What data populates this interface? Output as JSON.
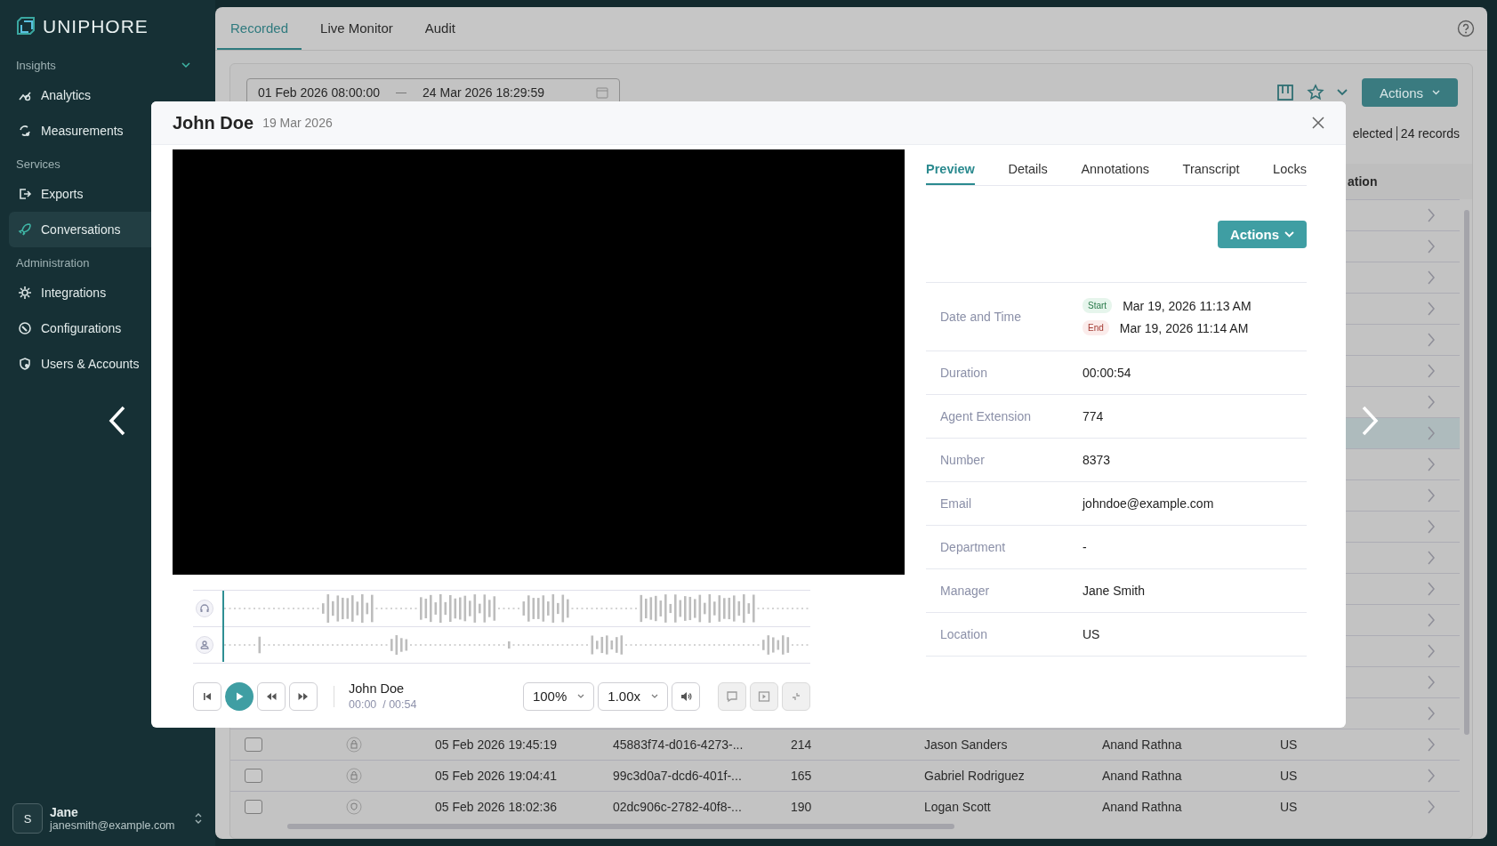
{
  "sidebar": {
    "logo": "UNIPHORE",
    "sections": [
      {
        "title": "Insights",
        "expanded": true,
        "items": [
          {
            "label": "Analytics",
            "selected": false
          },
          {
            "label": "Measurements",
            "selected": false
          }
        ]
      },
      {
        "title": "Services",
        "items": [
          {
            "label": "Exports",
            "selected": false
          },
          {
            "label": "Conversations",
            "selected": true
          }
        ]
      },
      {
        "title": "Administration",
        "items": [
          {
            "label": "Integrations",
            "selected": false
          },
          {
            "label": "Configurations",
            "selected": false
          },
          {
            "label": "Users & Accounts",
            "selected": false
          }
        ]
      }
    ],
    "user": {
      "initial": "S",
      "name": "Jane",
      "email": "janesmith@example.com"
    }
  },
  "tabs": [
    {
      "label": "Recorded",
      "selected": true
    },
    {
      "label": "Live Monitor",
      "selected": false
    },
    {
      "label": "Audit",
      "selected": false
    }
  ],
  "filters": {
    "date_from": "01 Feb 2026 08:00:00",
    "date_to": "24 Mar 2026 18:29:59",
    "actions": "Actions"
  },
  "summary": {
    "selected": "elected",
    "records": "24 records"
  },
  "table": {
    "header": "ation",
    "rows": [
      {
        "selected": false
      },
      {
        "selected": false
      },
      {
        "selected": false
      },
      {
        "selected": false
      },
      {
        "selected": false
      },
      {
        "selected": false
      },
      {
        "selected": false
      },
      {
        "selected": true
      },
      {
        "selected": false
      },
      {
        "selected": false
      },
      {
        "selected": false
      },
      {
        "selected": false
      },
      {
        "selected": false
      },
      {
        "selected": false
      },
      {
        "selected": false
      },
      {
        "selected": false
      },
      {
        "selected": false
      },
      {
        "selected": false,
        "checked": false,
        "cells": [
          "05 Feb 2026 19:45:19",
          "45883f74-d016-4273-...",
          "214",
          "Jason Sanders",
          "Anand Rathna",
          "US"
        ]
      },
      {
        "selected": false,
        "checked": false,
        "cells": [
          "05 Feb 2026 19:04:41",
          "99c3d0a7-dcd6-401f-...",
          "165",
          "Gabriel Rodriguez",
          "Anand Rathna",
          "US"
        ]
      },
      {
        "selected": false,
        "checked": false,
        "cells": [
          "05 Feb 2026 18:02:36",
          "02dc906c-2782-40f8-...",
          "190",
          "Logan Scott",
          "Anand Rathna",
          "US"
        ]
      }
    ]
  },
  "modal": {
    "title": "John Doe",
    "date": "19 Mar 2026",
    "tabs": [
      {
        "label": "Preview",
        "selected": true
      },
      {
        "label": "Details",
        "selected": false
      },
      {
        "label": "Annotations",
        "selected": false
      },
      {
        "label": "Transcript",
        "selected": false
      },
      {
        "label": "Locks",
        "selected": false
      }
    ],
    "actions": "Actions",
    "fields": [
      {
        "kind": "range",
        "label": "Date and Time",
        "start_badge": "Start",
        "start": "Mar 19, 2026 11:13 AM",
        "end_badge": "End",
        "end": "Mar 19, 2026 11:14 AM"
      },
      {
        "kind": "text",
        "label": "Duration",
        "value": "00:00:54"
      },
      {
        "kind": "text",
        "label": "Agent Extension",
        "value": "774"
      },
      {
        "kind": "text",
        "label": "Number",
        "value": "8373"
      },
      {
        "kind": "text",
        "label": "Email",
        "value": "johndoe@example.com"
      },
      {
        "kind": "text",
        "label": "Department",
        "value": "-"
      },
      {
        "kind": "text",
        "label": "Manager",
        "value": "Jane Smith"
      },
      {
        "kind": "text",
        "label": "Location",
        "value": "US"
      }
    ],
    "player": {
      "level": 0,
      "speaker": "John Doe",
      "time": "00:00  / 00:54",
      "zoom": "100%",
      "speed": "1.00x",
      "extra_buttons": [
        {
          "disabled": true
        },
        {
          "disabled": true
        },
        {
          "disabled": true
        }
      ]
    }
  }
}
